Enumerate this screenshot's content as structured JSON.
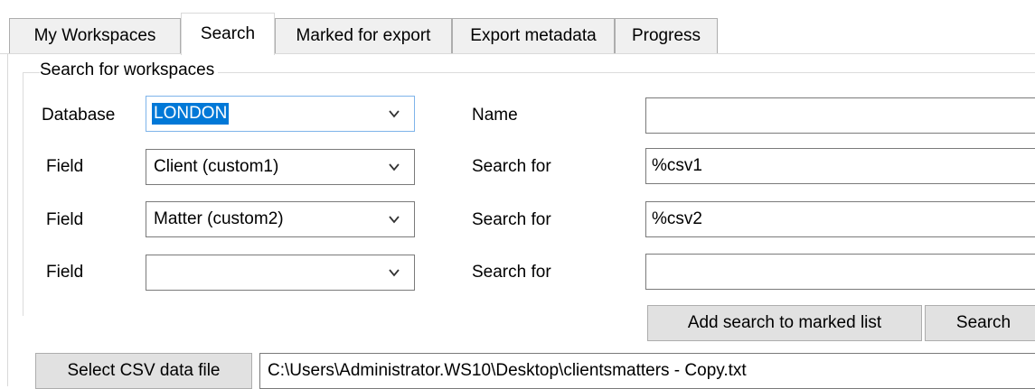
{
  "tabs": [
    {
      "label": "My Workspaces",
      "active": false
    },
    {
      "label": "Search",
      "active": true
    },
    {
      "label": "Marked for export",
      "active": false
    },
    {
      "label": "Export metadata",
      "active": false
    },
    {
      "label": "Progress",
      "active": false
    }
  ],
  "group": {
    "title": "Search for workspaces"
  },
  "form": {
    "database_label": "Database",
    "database_value": "LONDON",
    "name_label": "Name",
    "name_value": "",
    "rows": [
      {
        "field_label": "Field",
        "field_value": "Client (custom1)",
        "search_label": "Search for",
        "search_value": "%csv1"
      },
      {
        "field_label": "Field",
        "field_value": "Matter (custom2)",
        "search_label": "Search for",
        "search_value": "%csv2"
      },
      {
        "field_label": "Field",
        "field_value": "",
        "search_label": "Search for",
        "search_value": ""
      }
    ]
  },
  "buttons": {
    "add_to_marked": "Add search to marked list",
    "search": "Search",
    "select_csv": "Select CSV data file"
  },
  "csv": {
    "path": "C:\\Users\\Administrator.WS10\\Desktop\\clientsmatters - Copy.txt"
  },
  "icons": {
    "dropdown": "chevron-down-icon"
  },
  "colors": {
    "selection": "#0078d7",
    "focus_border": "#7eb4ea"
  }
}
